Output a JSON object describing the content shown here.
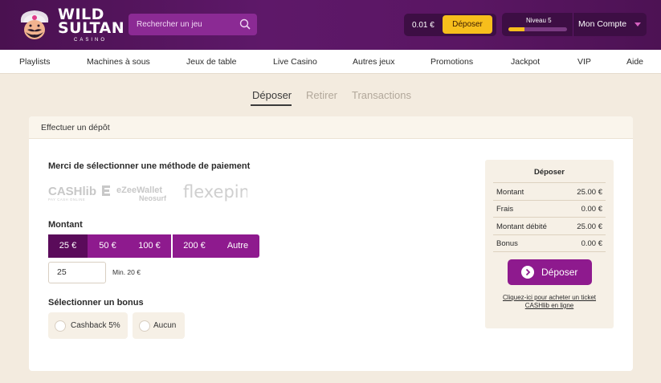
{
  "brand": {
    "name_line1": "WILD",
    "name_line2": "SULTAN",
    "name_sub": "CASINO"
  },
  "search": {
    "placeholder": "Rechercher un jeu"
  },
  "account": {
    "balance": "0.01 €",
    "deposit_label": "Déposer",
    "level_label": "Niveau 5",
    "level_progress": 0.28,
    "account_label": "Mon Compte"
  },
  "nav": {
    "items": [
      "Playlists",
      "Machines à sous",
      "Jeux de table",
      "Live Casino",
      "Autres jeux",
      "Promotions",
      "Jackpot",
      "VIP",
      "Aide"
    ]
  },
  "tabs": {
    "items": [
      "Déposer",
      "Retirer",
      "Transactions"
    ],
    "active": "Déposer"
  },
  "card": {
    "title": "Effectuer un dépôt",
    "payment_title": "Merci de sélectionner une méthode de paiement",
    "payment_methods": {
      "cashlib": "CASHlib",
      "cashlib_sub": "PAY CASH ONLINE",
      "ezee": "eZeeWallet",
      "ezee_sub": "Neosurf",
      "flexepin": "flexepin"
    },
    "amount_title": "Montant",
    "amount_options": [
      "25 €",
      "50 €",
      "100 €",
      "200 €",
      "Autre"
    ],
    "amount_selected": "25 €",
    "amount_value": "25",
    "min_text": "Min. 20 €",
    "bonus_title": "Sélectionner un bonus",
    "bonus_options": [
      "Cashback 5%",
      "Aucun"
    ]
  },
  "summary": {
    "title": "Déposer",
    "rows": [
      {
        "label": "Montant",
        "value": "25.00 €"
      },
      {
        "label": "Frais",
        "value": "0.00 €"
      },
      {
        "label": "Montant débité",
        "value": "25.00 €"
      },
      {
        "label": "Bonus",
        "value": "0.00 €"
      }
    ],
    "deposit_label": "Déposer",
    "link_line1": "Cliquez-ici pour acheter un ticket",
    "link_line2": "CASHlib en ligne"
  },
  "colors": {
    "header": "#5e1869",
    "accent_yellow": "#f7be1c",
    "primary_purple": "#8e1a8e",
    "primary_purple_active": "#5a0b5a",
    "page_bg": "#f3ebdf"
  }
}
